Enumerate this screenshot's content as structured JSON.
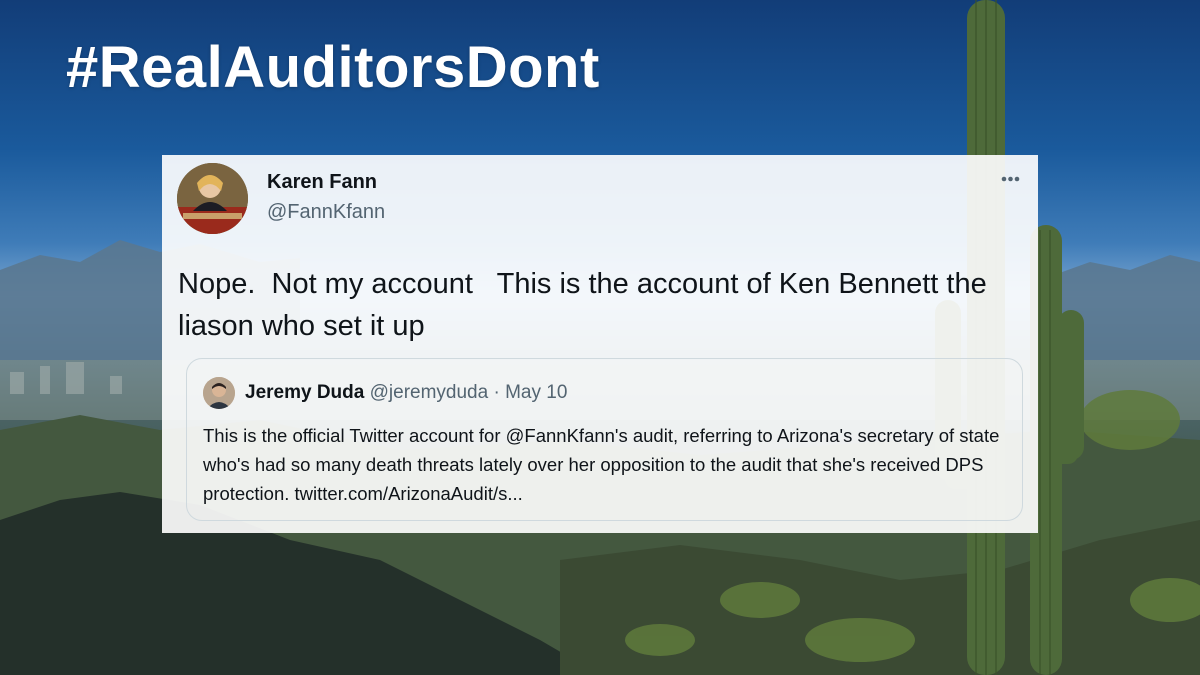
{
  "headline": "#RealAuditorsDont",
  "tweet": {
    "author_name": "Karen Fann",
    "author_handle": "@FannKfann",
    "text": "Nope.  Not my account   This is the account of Ken Bennett the  liason who set it up",
    "more_icon": "more-horizontal-icon",
    "quoted_tweet": {
      "author_name": "Jeremy Duda",
      "author_handle": "@jeremyduda",
      "separator": "·",
      "date": "May 10",
      "text": "This is the official Twitter account for @FannKfann's audit, referring to Arizona's secretary of state who's had so many death threats lately over her opposition to the audit that she's received DPS protection. twitter.com/ArizonaAudit/s..."
    }
  },
  "colors": {
    "name_text": "#0f1419",
    "secondary_text": "#536471",
    "card_background": "#ffffff",
    "border": "#cfd9de"
  }
}
